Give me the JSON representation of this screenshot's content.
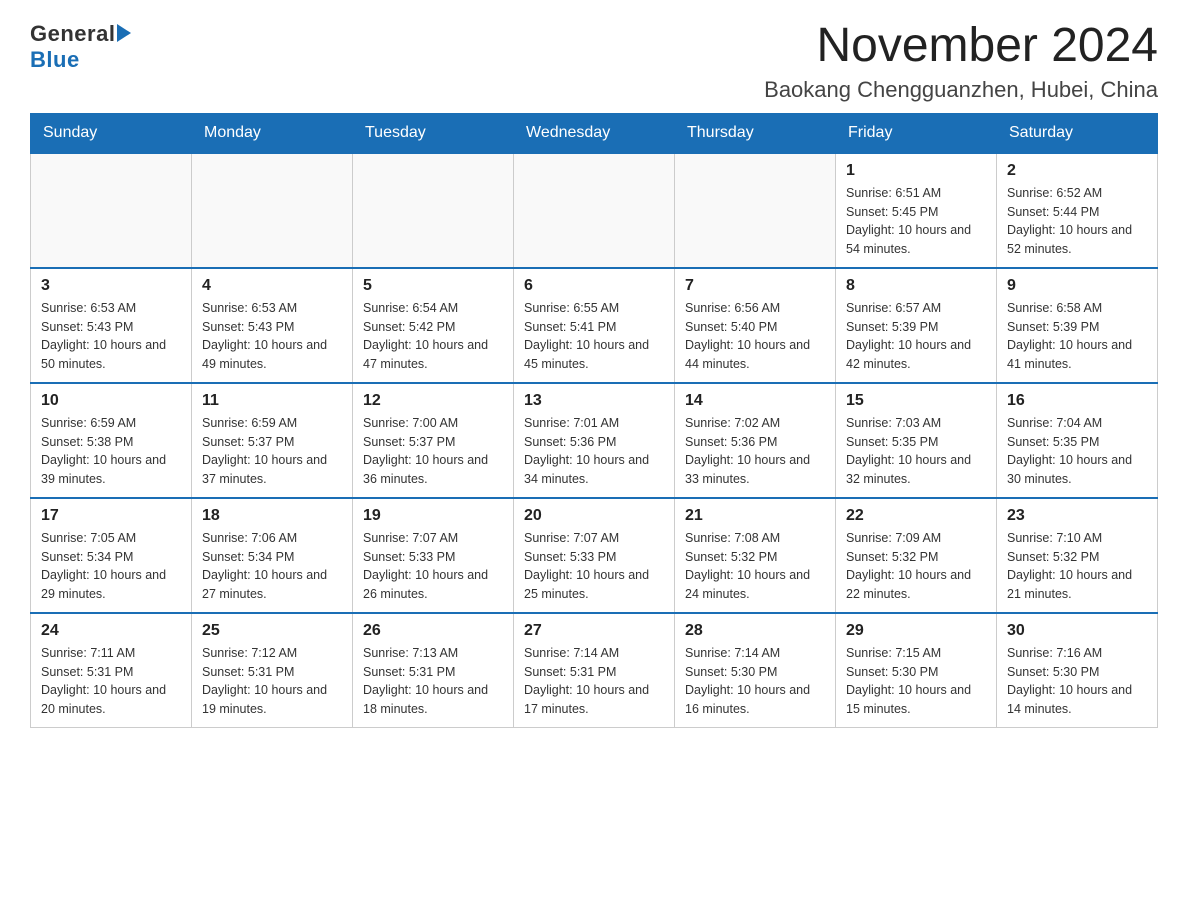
{
  "logo": {
    "general": "General",
    "blue": "Blue",
    "triangle": "▶"
  },
  "title": "November 2024",
  "location": "Baokang Chengguanzhen, Hubei, China",
  "days_of_week": [
    "Sunday",
    "Monday",
    "Tuesday",
    "Wednesday",
    "Thursday",
    "Friday",
    "Saturday"
  ],
  "weeks": [
    [
      {
        "day": "",
        "info": ""
      },
      {
        "day": "",
        "info": ""
      },
      {
        "day": "",
        "info": ""
      },
      {
        "day": "",
        "info": ""
      },
      {
        "day": "",
        "info": ""
      },
      {
        "day": "1",
        "info": "Sunrise: 6:51 AM\nSunset: 5:45 PM\nDaylight: 10 hours and 54 minutes."
      },
      {
        "day": "2",
        "info": "Sunrise: 6:52 AM\nSunset: 5:44 PM\nDaylight: 10 hours and 52 minutes."
      }
    ],
    [
      {
        "day": "3",
        "info": "Sunrise: 6:53 AM\nSunset: 5:43 PM\nDaylight: 10 hours and 50 minutes."
      },
      {
        "day": "4",
        "info": "Sunrise: 6:53 AM\nSunset: 5:43 PM\nDaylight: 10 hours and 49 minutes."
      },
      {
        "day": "5",
        "info": "Sunrise: 6:54 AM\nSunset: 5:42 PM\nDaylight: 10 hours and 47 minutes."
      },
      {
        "day": "6",
        "info": "Sunrise: 6:55 AM\nSunset: 5:41 PM\nDaylight: 10 hours and 45 minutes."
      },
      {
        "day": "7",
        "info": "Sunrise: 6:56 AM\nSunset: 5:40 PM\nDaylight: 10 hours and 44 minutes."
      },
      {
        "day": "8",
        "info": "Sunrise: 6:57 AM\nSunset: 5:39 PM\nDaylight: 10 hours and 42 minutes."
      },
      {
        "day": "9",
        "info": "Sunrise: 6:58 AM\nSunset: 5:39 PM\nDaylight: 10 hours and 41 minutes."
      }
    ],
    [
      {
        "day": "10",
        "info": "Sunrise: 6:59 AM\nSunset: 5:38 PM\nDaylight: 10 hours and 39 minutes."
      },
      {
        "day": "11",
        "info": "Sunrise: 6:59 AM\nSunset: 5:37 PM\nDaylight: 10 hours and 37 minutes."
      },
      {
        "day": "12",
        "info": "Sunrise: 7:00 AM\nSunset: 5:37 PM\nDaylight: 10 hours and 36 minutes."
      },
      {
        "day": "13",
        "info": "Sunrise: 7:01 AM\nSunset: 5:36 PM\nDaylight: 10 hours and 34 minutes."
      },
      {
        "day": "14",
        "info": "Sunrise: 7:02 AM\nSunset: 5:36 PM\nDaylight: 10 hours and 33 minutes."
      },
      {
        "day": "15",
        "info": "Sunrise: 7:03 AM\nSunset: 5:35 PM\nDaylight: 10 hours and 32 minutes."
      },
      {
        "day": "16",
        "info": "Sunrise: 7:04 AM\nSunset: 5:35 PM\nDaylight: 10 hours and 30 minutes."
      }
    ],
    [
      {
        "day": "17",
        "info": "Sunrise: 7:05 AM\nSunset: 5:34 PM\nDaylight: 10 hours and 29 minutes."
      },
      {
        "day": "18",
        "info": "Sunrise: 7:06 AM\nSunset: 5:34 PM\nDaylight: 10 hours and 27 minutes."
      },
      {
        "day": "19",
        "info": "Sunrise: 7:07 AM\nSunset: 5:33 PM\nDaylight: 10 hours and 26 minutes."
      },
      {
        "day": "20",
        "info": "Sunrise: 7:07 AM\nSunset: 5:33 PM\nDaylight: 10 hours and 25 minutes."
      },
      {
        "day": "21",
        "info": "Sunrise: 7:08 AM\nSunset: 5:32 PM\nDaylight: 10 hours and 24 minutes."
      },
      {
        "day": "22",
        "info": "Sunrise: 7:09 AM\nSunset: 5:32 PM\nDaylight: 10 hours and 22 minutes."
      },
      {
        "day": "23",
        "info": "Sunrise: 7:10 AM\nSunset: 5:32 PM\nDaylight: 10 hours and 21 minutes."
      }
    ],
    [
      {
        "day": "24",
        "info": "Sunrise: 7:11 AM\nSunset: 5:31 PM\nDaylight: 10 hours and 20 minutes."
      },
      {
        "day": "25",
        "info": "Sunrise: 7:12 AM\nSunset: 5:31 PM\nDaylight: 10 hours and 19 minutes."
      },
      {
        "day": "26",
        "info": "Sunrise: 7:13 AM\nSunset: 5:31 PM\nDaylight: 10 hours and 18 minutes."
      },
      {
        "day": "27",
        "info": "Sunrise: 7:14 AM\nSunset: 5:31 PM\nDaylight: 10 hours and 17 minutes."
      },
      {
        "day": "28",
        "info": "Sunrise: 7:14 AM\nSunset: 5:30 PM\nDaylight: 10 hours and 16 minutes."
      },
      {
        "day": "29",
        "info": "Sunrise: 7:15 AM\nSunset: 5:30 PM\nDaylight: 10 hours and 15 minutes."
      },
      {
        "day": "30",
        "info": "Sunrise: 7:16 AM\nSunset: 5:30 PM\nDaylight: 10 hours and 14 minutes."
      }
    ]
  ]
}
